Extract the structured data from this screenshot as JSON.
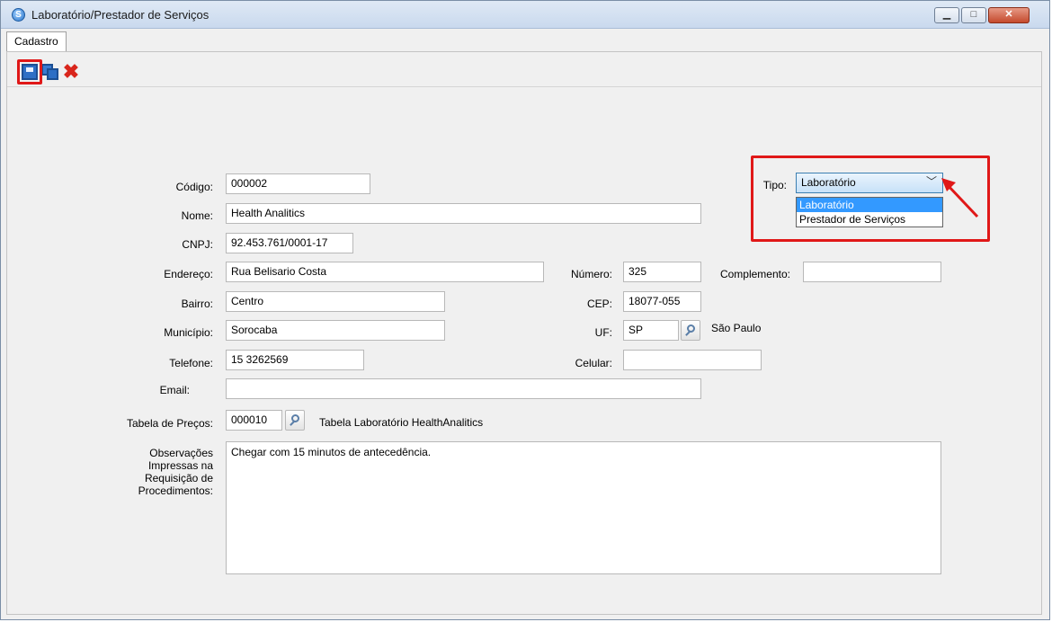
{
  "window": {
    "title": "Laboratório/Prestador de Serviços",
    "minimize_label": "▁",
    "maximize_label": "□",
    "close_label": "✕"
  },
  "tabs": [
    {
      "label": "Cadastro"
    }
  ],
  "toolbar": {
    "icons": [
      "save-icon",
      "save-as-icon",
      "cancel-icon"
    ],
    "highlight_color": "#e01818"
  },
  "form": {
    "codigo": {
      "label": "Código:",
      "value": "000002"
    },
    "nome": {
      "label": "Nome:",
      "value": "Health Analitics"
    },
    "cnpj": {
      "label": "CNPJ:",
      "value": "92.453.761/0001-17"
    },
    "endereco": {
      "label": "Endereço:",
      "value": "Rua Belisario Costa"
    },
    "numero": {
      "label": "Número:",
      "value": "325"
    },
    "complemento": {
      "label": "Complemento:",
      "value": ""
    },
    "bairro": {
      "label": "Bairro:",
      "value": "Centro"
    },
    "cep": {
      "label": "CEP:",
      "value": "18077-055"
    },
    "municipio": {
      "label": "Município:",
      "value": "Sorocaba"
    },
    "uf": {
      "label": "UF:",
      "value": "SP",
      "description": "São Paulo"
    },
    "telefone": {
      "label": "Telefone:",
      "value": "15 3262569"
    },
    "celular": {
      "label": "Celular:",
      "value": ""
    },
    "email": {
      "label": "Email:",
      "value": ""
    },
    "tabela_precos": {
      "label": "Tabela de Preços:",
      "value": "000010",
      "description": "Tabela Laboratório HealthAnalitics"
    },
    "observacoes": {
      "label_lines": [
        "Observações",
        "Impressas na",
        "Requisição de",
        "Procedimentos:"
      ],
      "value": "Chegar com 15 minutos de antecedência."
    },
    "tipo": {
      "label": "Tipo:",
      "value": "Laboratório",
      "options": [
        "Laboratório",
        "Prestador de Serviços"
      ],
      "selected_index": 0
    }
  }
}
